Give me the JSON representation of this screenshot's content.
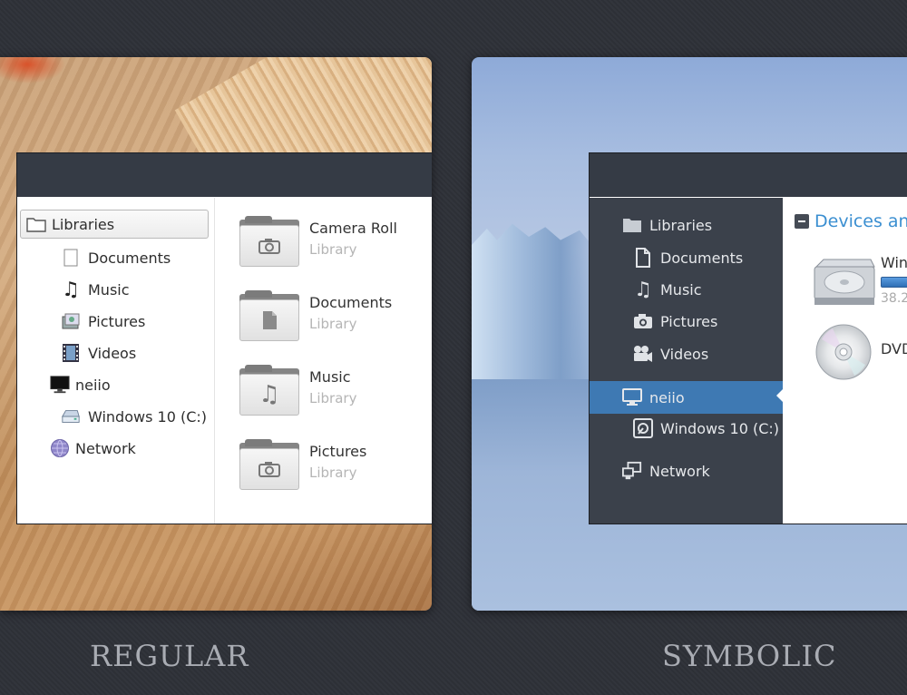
{
  "captions": {
    "regular": "REGULAR",
    "symbolic": "SYMBOLIC"
  },
  "regular": {
    "sidebar": {
      "libraries": "Libraries",
      "documents": "Documents",
      "music": "Music",
      "pictures": "Pictures",
      "videos": "Videos",
      "computer": "neiio",
      "drive": "Windows 10 (C:)",
      "network": "Network"
    },
    "libraries": [
      {
        "name": "Camera Roll",
        "sub": "Library",
        "icon": "camera-icon"
      },
      {
        "name": "Documents",
        "sub": "Library",
        "icon": "document-icon"
      },
      {
        "name": "Music",
        "sub": "Library",
        "icon": "music-icon"
      },
      {
        "name": "Pictures",
        "sub": "Library",
        "icon": "camera-icon"
      }
    ]
  },
  "symbolic": {
    "sidebar": {
      "libraries": "Libraries",
      "documents": "Documents",
      "music": "Music",
      "pictures": "Pictures",
      "videos": "Videos",
      "computer": "neiio",
      "drive": "Windows 10 (C:)",
      "network": "Network"
    },
    "section_title": "Devices an",
    "devices": [
      {
        "name": "Win",
        "size": "38.2",
        "icon": "hard-drive-icon"
      },
      {
        "name": "DVD",
        "icon": "dvd-icon"
      }
    ]
  },
  "colors": {
    "accent": "#3b8fd1",
    "selection_symbolic": "#3e79b3",
    "titlebar": "#353b45"
  }
}
